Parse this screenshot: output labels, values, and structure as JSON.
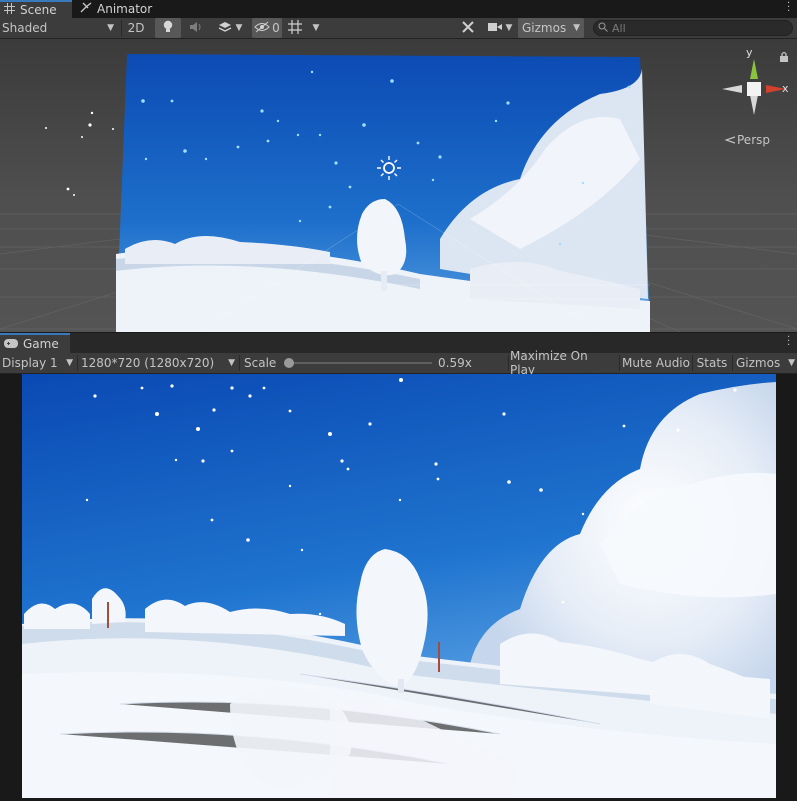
{
  "scene_tabs": [
    {
      "label": "Scene",
      "icon": "grid-icon",
      "active": true
    },
    {
      "label": "Animator",
      "icon": "animator-icon",
      "active": false
    }
  ],
  "scene_toolbar": {
    "draw_mode": "Shaded",
    "mode_2d": "2D",
    "hidden_count": "0",
    "gizmos": "Gizmos",
    "search_placeholder": "All"
  },
  "gizmo": {
    "y_label": "y",
    "x_label": "x",
    "projection": "Persp"
  },
  "game_tab": {
    "label": "Game",
    "icon": "gamepad-icon"
  },
  "game_toolbar": {
    "display": "Display 1",
    "resolution": "1280*720 (1280x720)",
    "scale_label": "Scale",
    "scale_value": "0.59x",
    "scale_fraction": 0.0,
    "maximize": "Maximize On Play",
    "mute": "Mute Audio",
    "stats": "Stats",
    "gizmos": "Gizmos"
  },
  "colors": {
    "panel": "#3c3c3c",
    "tab_active_accent": "#3a79bb",
    "sky_top": "#0c4bb4",
    "sky_mid": "#2277d0",
    "snow": "#eef3fa",
    "axis_y": "#8ac43f",
    "axis_x": "#d2412c"
  }
}
